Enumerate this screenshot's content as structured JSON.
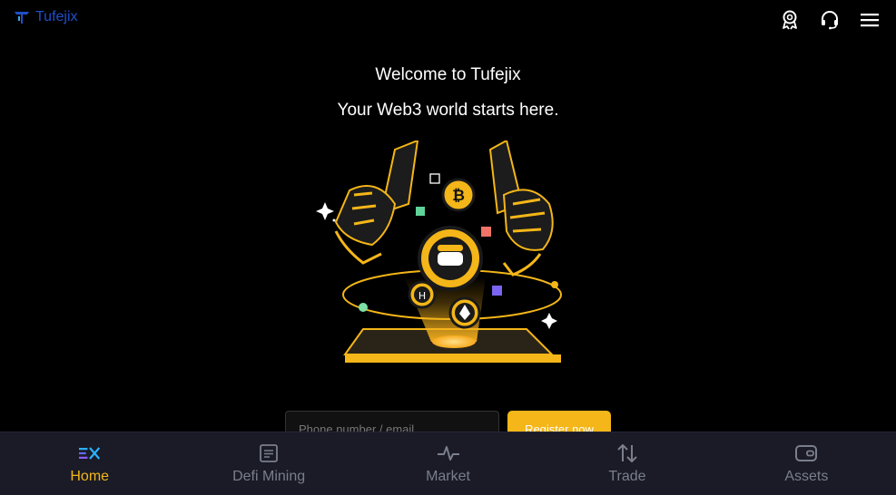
{
  "header": {
    "brand": "Tufejix"
  },
  "hero": {
    "title": "Welcome to Tufejix",
    "subtitle": "Your Web3 world starts here."
  },
  "signup": {
    "placeholder": "Phone number / email",
    "button": "Register now"
  },
  "nav": {
    "items": [
      {
        "label": "Home",
        "icon": "home-ex-icon",
        "active": true
      },
      {
        "label": "Defi Mining",
        "icon": "document-icon",
        "active": false
      },
      {
        "label": "Market",
        "icon": "pulse-icon",
        "active": false
      },
      {
        "label": "Trade",
        "icon": "swap-arrows-icon",
        "active": false
      },
      {
        "label": "Assets",
        "icon": "wallet-icon",
        "active": false
      }
    ]
  },
  "colors": {
    "accent": "#f4b618",
    "brand": "#1f4fc9",
    "nav_bg": "#1a1b27",
    "inactive": "#7b7e8c"
  }
}
